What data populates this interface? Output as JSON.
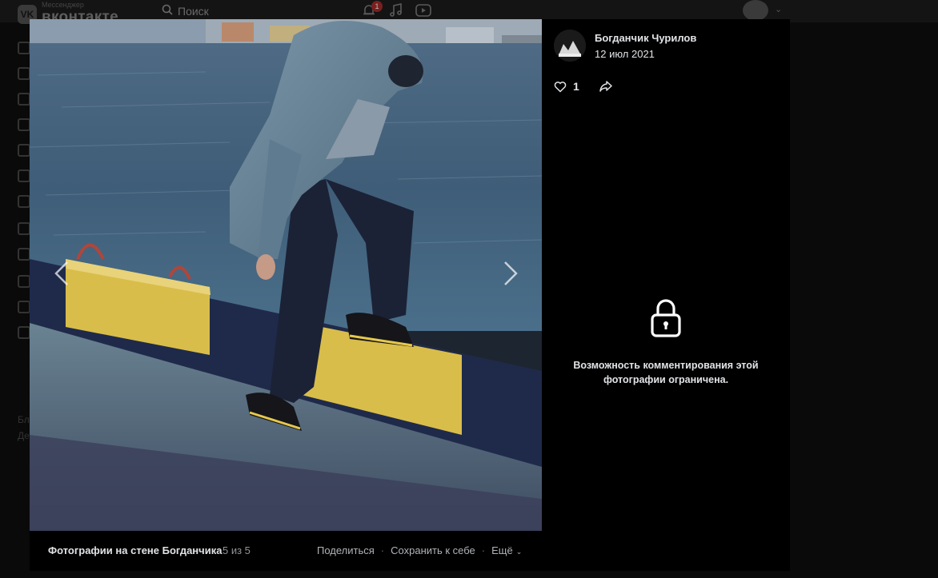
{
  "background_page": {
    "logo_text": "вконтакте",
    "logo_subtext": "Мессенджер",
    "search_placeholder": "Поиск",
    "notifications_count": "1",
    "sidebar_fragment_1": "Бл",
    "sidebar_fragment_2": "Де"
  },
  "viewer": {
    "album_title": "Фотографии на стене Богданчика",
    "counter": "5 из 5",
    "actions": {
      "share": "Поделиться",
      "save": "Сохранить к себе",
      "more": "Ещё"
    }
  },
  "panel": {
    "author_name": "Богданчик Чурилов",
    "date": "12 июл 2021",
    "likes": "1",
    "comments_restricted_text": "Возможность комментирования этой фотографии ограничена."
  },
  "colors": {
    "background": "#0a0a0a",
    "panel": "#000000",
    "text_primary": "#e1e3e6",
    "text_secondary": "#909499",
    "badge": "#7a1f1f"
  }
}
